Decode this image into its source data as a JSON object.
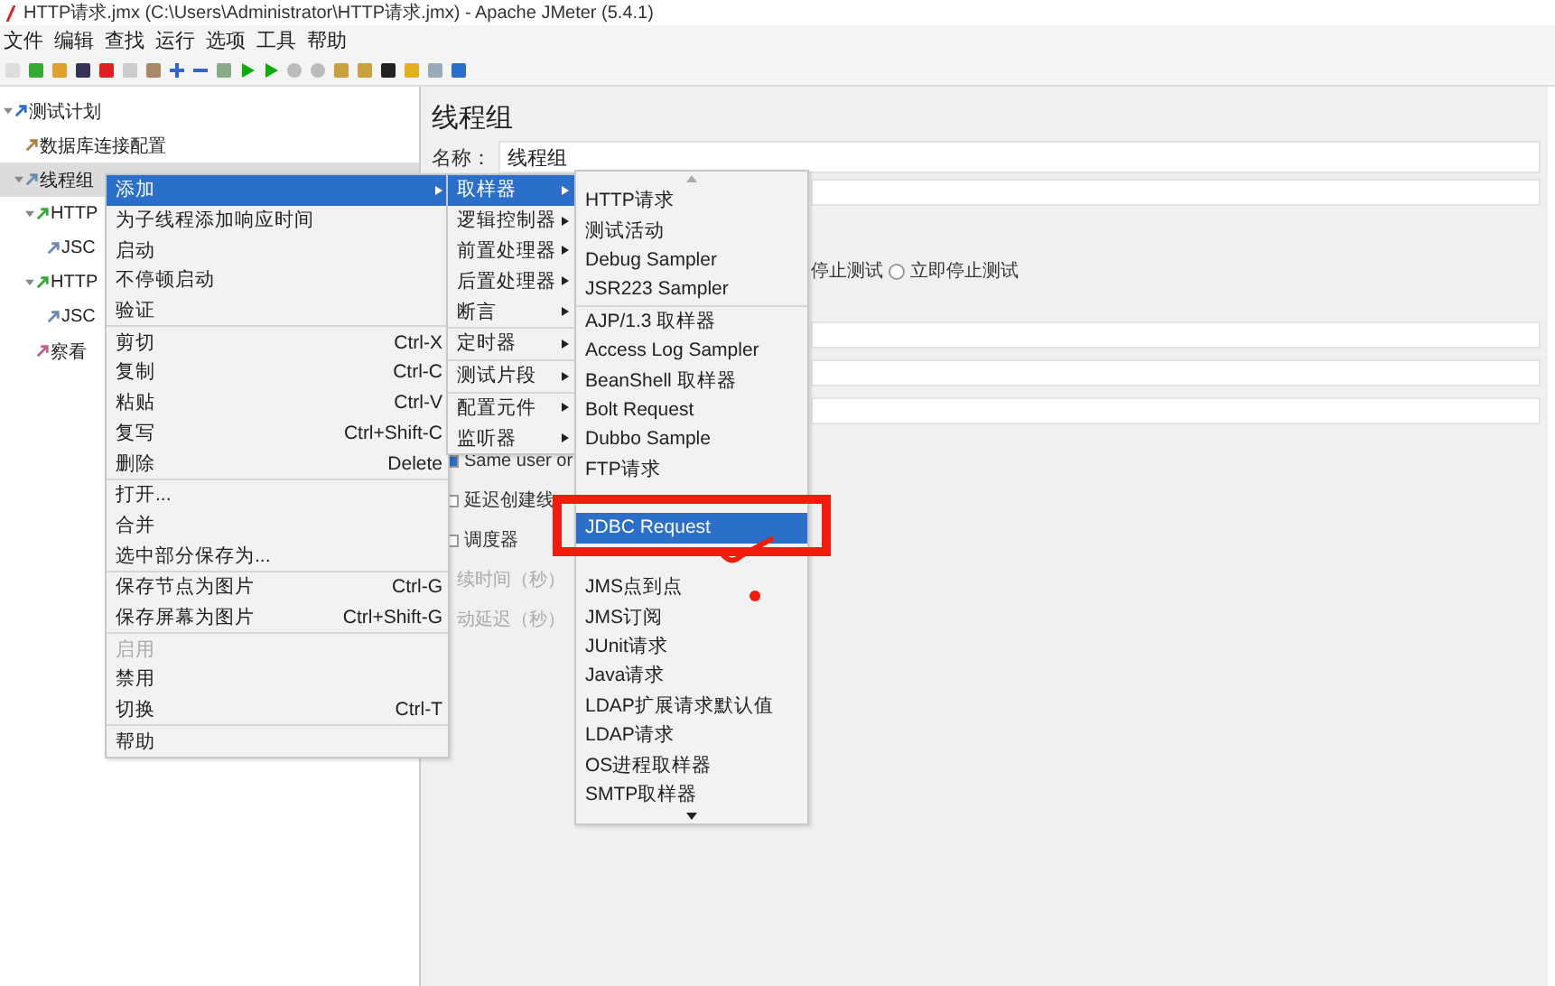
{
  "window": {
    "title": "HTTP请求.jmx (C:\\Users\\Administrator\\HTTP请求.jmx) - Apache JMeter (5.4.1)"
  },
  "menu_bar": [
    "文件",
    "编辑",
    "查找",
    "运行",
    "选项",
    "工具",
    "帮助"
  ],
  "tree": [
    {
      "label": "测试计划",
      "kind": "plan",
      "expanded": true,
      "selected": false,
      "children": [
        {
          "label": "数据库连接配置",
          "kind": "config",
          "selected": false
        },
        {
          "label": "线程组",
          "kind": "threads",
          "expanded": true,
          "selected": true,
          "children": [
            {
              "label": "HTTP",
              "kind": "sampler",
              "expanded": true,
              "selected": false,
              "children": [
                {
                  "label": "JSC",
                  "kind": "extractor",
                  "selected": false
                }
              ]
            },
            {
              "label": "HTTP",
              "kind": "sampler",
              "expanded": true,
              "selected": false,
              "children": [
                {
                  "label": "JSC",
                  "kind": "extractor",
                  "selected": false
                }
              ]
            },
            {
              "label": "察看",
              "kind": "listener",
              "selected": false
            }
          ]
        }
      ]
    }
  ],
  "panel": {
    "title": "线程组",
    "name_label": "名称：",
    "name_value": "线程组",
    "radio_text": "停止测试",
    "radio_option": {
      "label": "立即停止测试",
      "selected": false
    },
    "checks": [
      {
        "label": "Same user or",
        "checked": true,
        "disabled": false
      },
      {
        "label": "延迟创建线",
        "checked": false,
        "disabled": false
      },
      {
        "label": "调度器",
        "checked": false,
        "disabled": false
      }
    ],
    "greyed": [
      "续时间（秒）",
      "动延迟（秒）"
    ]
  },
  "context_menu": [
    {
      "kind": "item",
      "label": "添加",
      "submenu": true,
      "selected": true,
      "disabled": false
    },
    {
      "kind": "item",
      "label": "为子线程添加响应时间",
      "selected": false,
      "disabled": false
    },
    {
      "kind": "item",
      "label": "启动",
      "selected": false,
      "disabled": false
    },
    {
      "kind": "item",
      "label": "不停顿启动",
      "selected": false,
      "disabled": false
    },
    {
      "kind": "item",
      "label": "验证",
      "selected": false,
      "disabled": false
    },
    {
      "kind": "item",
      "label": "剪切",
      "shortcut": "Ctrl-X",
      "separator_before": true,
      "selected": false,
      "disabled": false
    },
    {
      "kind": "item",
      "label": "复制",
      "shortcut": "Ctrl-C",
      "selected": false,
      "disabled": false
    },
    {
      "kind": "item",
      "label": "粘贴",
      "shortcut": "Ctrl-V",
      "selected": false,
      "disabled": false
    },
    {
      "kind": "item",
      "label": "复写",
      "shortcut": "Ctrl+Shift-C",
      "selected": false,
      "disabled": false
    },
    {
      "kind": "item",
      "label": "删除",
      "shortcut": "Delete",
      "selected": false,
      "disabled": false
    },
    {
      "kind": "item",
      "label": "打开...",
      "separator_before": true,
      "selected": false,
      "disabled": false
    },
    {
      "kind": "item",
      "label": "合并",
      "selected": false,
      "disabled": false
    },
    {
      "kind": "item",
      "label": "选中部分保存为...",
      "selected": false,
      "disabled": false
    },
    {
      "kind": "item",
      "label": "保存节点为图片",
      "shortcut": "Ctrl-G",
      "separator_before": true,
      "selected": false,
      "disabled": false
    },
    {
      "kind": "item",
      "label": "保存屏幕为图片",
      "shortcut": "Ctrl+Shift-G",
      "selected": false,
      "disabled": false
    },
    {
      "kind": "item",
      "label": "启用",
      "separator_before": true,
      "selected": false,
      "disabled": true
    },
    {
      "kind": "item",
      "label": "禁用",
      "selected": false,
      "disabled": false
    },
    {
      "kind": "item",
      "label": "切换",
      "shortcut": "Ctrl-T",
      "selected": false,
      "disabled": false
    },
    {
      "kind": "item",
      "label": "帮助",
      "separator_before": true,
      "selected": false,
      "disabled": false
    }
  ],
  "add_menu": [
    {
      "kind": "item",
      "label": "取样器",
      "submenu": true,
      "selected": true,
      "disabled": false
    },
    {
      "kind": "item",
      "label": "逻辑控制器",
      "submenu": true,
      "selected": false,
      "disabled": false
    },
    {
      "kind": "item",
      "label": "前置处理器",
      "submenu": true,
      "selected": false,
      "disabled": false
    },
    {
      "kind": "item",
      "label": "后置处理器",
      "submenu": true,
      "selected": false,
      "disabled": false
    },
    {
      "kind": "item",
      "label": "断言",
      "submenu": true,
      "selected": false,
      "disabled": false
    },
    {
      "kind": "item",
      "label": "定时器",
      "submenu": true,
      "separator_before": true,
      "selected": false,
      "disabled": false
    },
    {
      "kind": "item",
      "label": "测试片段",
      "submenu": true,
      "separator_before": true,
      "selected": false,
      "disabled": false
    },
    {
      "kind": "item",
      "label": "配置元件",
      "submenu": true,
      "separator_before": true,
      "selected": false,
      "disabled": false
    },
    {
      "kind": "item",
      "label": "监听器",
      "submenu": true,
      "selected": false,
      "disabled": false
    }
  ],
  "sampler_menu": [
    {
      "kind": "item",
      "label": "HTTP请求",
      "selected": false,
      "disabled": false
    },
    {
      "kind": "item",
      "label": "测试活动",
      "selected": false,
      "disabled": false
    },
    {
      "kind": "item",
      "label": "Debug Sampler",
      "selected": false,
      "disabled": false
    },
    {
      "kind": "item",
      "label": "JSR223 Sampler",
      "selected": false,
      "disabled": false
    },
    {
      "kind": "item",
      "label": "AJP/1.3 取样器",
      "separator_before": true,
      "selected": false,
      "disabled": false
    },
    {
      "kind": "item",
      "label": "Access Log Sampler",
      "selected": false,
      "disabled": false
    },
    {
      "kind": "item",
      "label": "BeanShell 取样器",
      "selected": false,
      "disabled": false
    },
    {
      "kind": "item",
      "label": "Bolt Request",
      "selected": false,
      "disabled": false
    },
    {
      "kind": "item",
      "label": "Dubbo Sample",
      "selected": false,
      "disabled": false
    },
    {
      "kind": "item",
      "label": "FTP请求",
      "selected": false,
      "disabled": false
    },
    {
      "kind": "covered"
    },
    {
      "kind": "item",
      "label": "JDBC Request",
      "selected": true,
      "disabled": false
    },
    {
      "kind": "covered"
    },
    {
      "kind": "item",
      "label": "JMS点到点",
      "selected": false,
      "disabled": false
    },
    {
      "kind": "item",
      "label": "JMS订阅",
      "selected": false,
      "disabled": false
    },
    {
      "kind": "item",
      "label": "JUnit请求",
      "selected": false,
      "disabled": false
    },
    {
      "kind": "item",
      "label": "Java请求",
      "selected": false,
      "disabled": false
    },
    {
      "kind": "item",
      "label": "LDAP扩展请求默认值",
      "selected": false,
      "disabled": false
    },
    {
      "kind": "item",
      "label": "LDAP请求",
      "selected": false,
      "disabled": false
    },
    {
      "kind": "item",
      "label": "OS进程取样器",
      "selected": false,
      "disabled": false
    },
    {
      "kind": "item",
      "label": "SMTP取样器",
      "selected": false,
      "disabled": false
    }
  ]
}
